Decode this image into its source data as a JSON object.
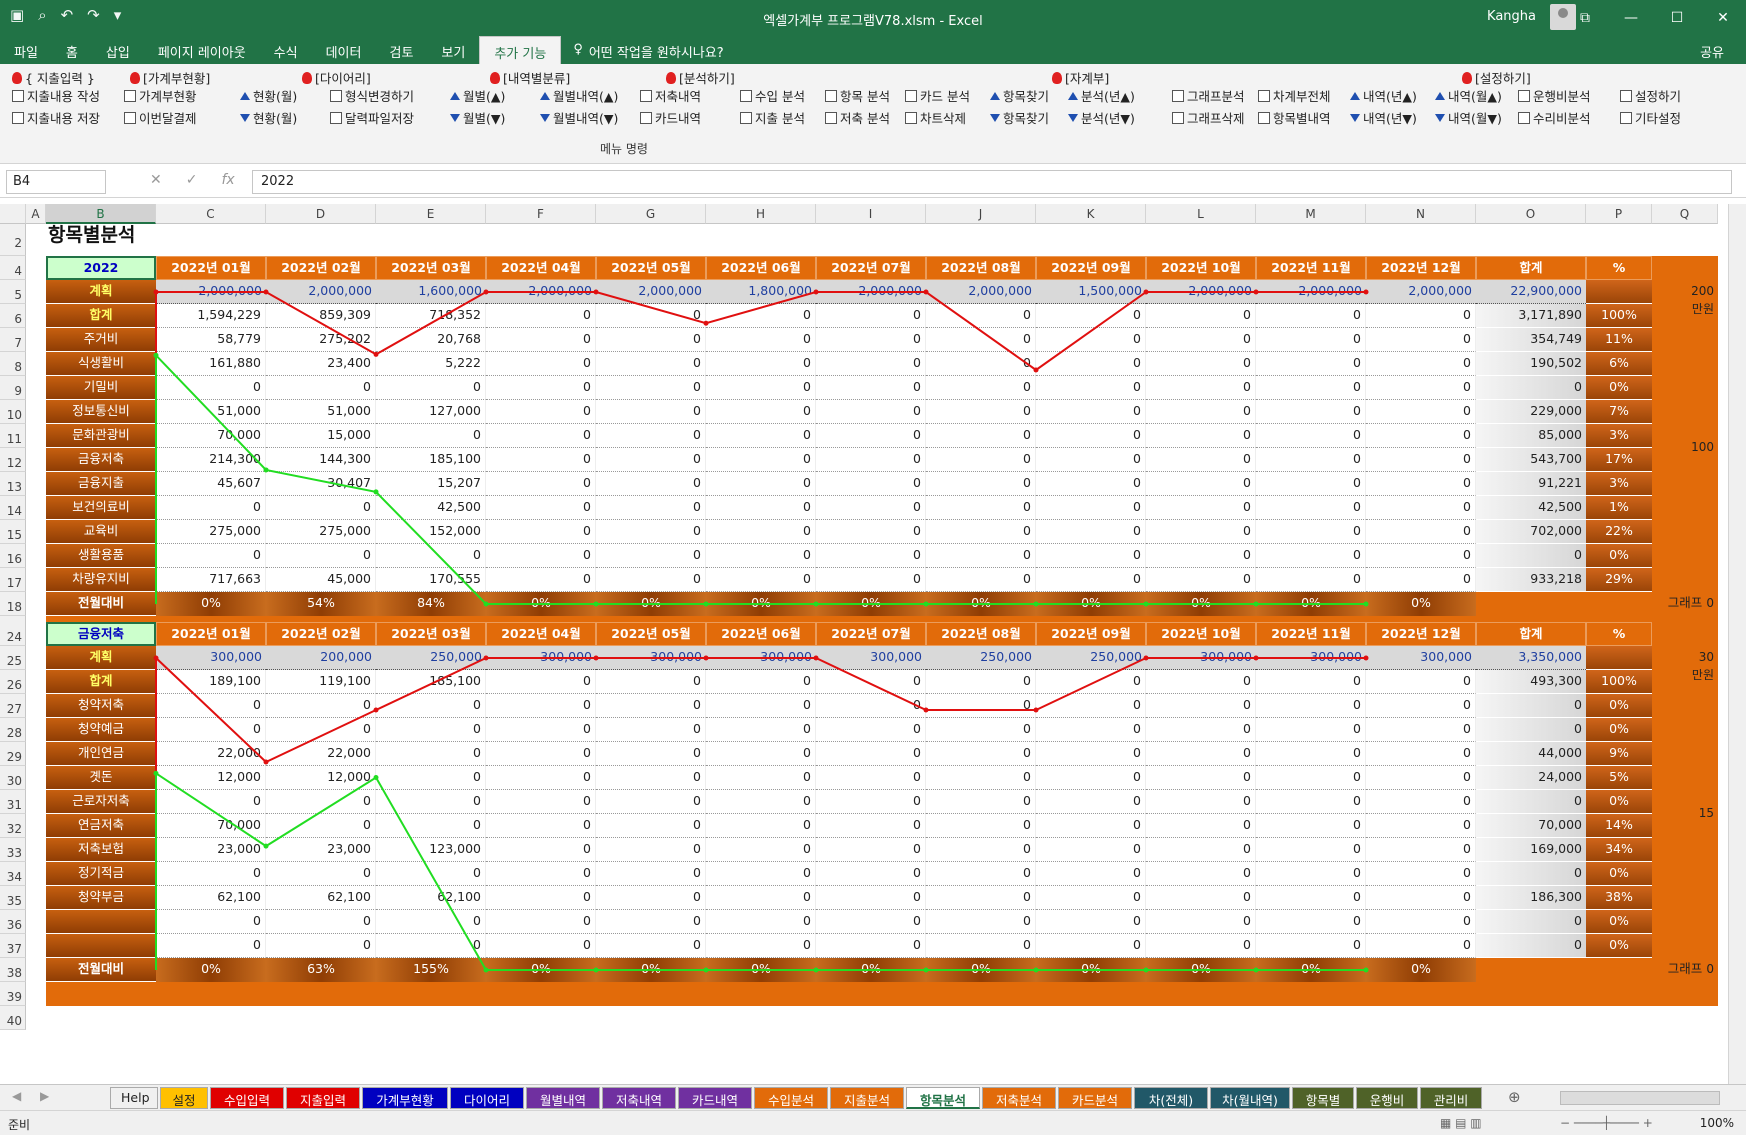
{
  "window": {
    "title": "엑셀가계부 프로그램V78.xlsm  -  Excel",
    "user": "Kangha",
    "qat_icons": [
      "save-icon",
      "print-preview-icon",
      "undo-icon",
      "redo-icon",
      "customize-icon"
    ]
  },
  "tabs": [
    "파일",
    "홈",
    "삽입",
    "페이지 레이아웃",
    "수식",
    "데이터",
    "검토",
    "보기",
    "추가 기능"
  ],
  "active_tab": "추가 기능",
  "tell_me": "어떤 작업을 원하시나요?",
  "share": "공유",
  "ribbon": {
    "headers": [
      "{ 지출입력 }",
      "[가계부현황]",
      "[다이어리]",
      "[내역별분류]",
      "[분석하기]",
      "[자계부]",
      "[설정하기]"
    ],
    "row1": [
      "지출내용 작성",
      "가계부현황",
      "현황(월)",
      "형식변경하기",
      "월별(▲)",
      "월별내역(▲)",
      "저축내역",
      "수입 분석",
      "항목 분석",
      "카드 분석",
      "항목찾기",
      "분석(년▲)",
      "그래프분석",
      "차계부전체",
      "내역(년▲)",
      "내역(월▲)",
      "운행비분석",
      "설정하기"
    ],
    "row2": [
      "지출내용 저장",
      "이번달결제",
      "현황(월)",
      "달력파일저장",
      "월별(▼)",
      "월별내역(▼)",
      "카드내역",
      "지출 분석",
      "저축 분석",
      "차트삭제",
      "항목찾기",
      "분석(년▼)",
      "그래프삭제",
      "항목별내역",
      "내역(년▼)",
      "내역(월▼)",
      "수리비분석",
      "기타설정"
    ],
    "group_label": "메뉴 명령"
  },
  "formula_bar": {
    "name_box": "B4",
    "value": "2022"
  },
  "columns": [
    "A",
    "B",
    "C",
    "D",
    "E",
    "F",
    "G",
    "H",
    "I",
    "J",
    "K",
    "L",
    "M",
    "N",
    "O",
    "P",
    "Q"
  ],
  "selected_column": "B",
  "sheet_title": "항목별분석",
  "months": [
    "2022년 01월",
    "2022년 02월",
    "2022년 03월",
    "2022년 04월",
    "2022년 05월",
    "2022년 06월",
    "2022년 07월",
    "2022년 08월",
    "2022년 09월",
    "2022년 10월",
    "2022년 11월",
    "2022년 12월"
  ],
  "total_label": "합계",
  "pct_label": "%",
  "compare_label": "전월대비",
  "graph_label": "그래프",
  "unit_label": "만원",
  "table1": {
    "selector": "2022",
    "rows": [
      {
        "row": "5",
        "label": "계획",
        "type": "plan",
        "values": [
          "2,000,000",
          "2,000,000",
          "1,600,000",
          "2,000,000",
          "2,000,000",
          "1,800,000",
          "2,000,000",
          "2,000,000",
          "1,500,000",
          "2,000,000",
          "2,000,000",
          "2,000,000"
        ],
        "total": "22,900,000",
        "pct": ""
      },
      {
        "row": "6",
        "label": "합계",
        "type": "sum",
        "values": [
          "1,594,229",
          "859,309",
          "718,352",
          "0",
          "0",
          "0",
          "0",
          "0",
          "0",
          "0",
          "0",
          "0"
        ],
        "total": "3,171,890",
        "pct": "100%"
      },
      {
        "row": "7",
        "label": "주거비",
        "values": [
          "58,779",
          "275,202",
          "20,768",
          "0",
          "0",
          "0",
          "0",
          "0",
          "0",
          "0",
          "0",
          "0"
        ],
        "total": "354,749",
        "pct": "11%"
      },
      {
        "row": "8",
        "label": "식생활비",
        "values": [
          "161,880",
          "23,400",
          "5,222",
          "0",
          "0",
          "0",
          "0",
          "0",
          "0",
          "0",
          "0",
          "0"
        ],
        "total": "190,502",
        "pct": "6%"
      },
      {
        "row": "9",
        "label": "기밀비",
        "values": [
          "0",
          "0",
          "0",
          "0",
          "0",
          "0",
          "0",
          "0",
          "0",
          "0",
          "0",
          "0"
        ],
        "total": "0",
        "pct": "0%"
      },
      {
        "row": "10",
        "label": "정보통신비",
        "values": [
          "51,000",
          "51,000",
          "127,000",
          "0",
          "0",
          "0",
          "0",
          "0",
          "0",
          "0",
          "0",
          "0"
        ],
        "total": "229,000",
        "pct": "7%"
      },
      {
        "row": "11",
        "label": "문화관광비",
        "values": [
          "70,000",
          "15,000",
          "0",
          "0",
          "0",
          "0",
          "0",
          "0",
          "0",
          "0",
          "0",
          "0"
        ],
        "total": "85,000",
        "pct": "3%"
      },
      {
        "row": "12",
        "label": "금융저축",
        "values": [
          "214,300",
          "144,300",
          "185,100",
          "0",
          "0",
          "0",
          "0",
          "0",
          "0",
          "0",
          "0",
          "0"
        ],
        "total": "543,700",
        "pct": "17%"
      },
      {
        "row": "13",
        "label": "금융지출",
        "values": [
          "45,607",
          "30,407",
          "15,207",
          "0",
          "0",
          "0",
          "0",
          "0",
          "0",
          "0",
          "0",
          "0"
        ],
        "total": "91,221",
        "pct": "3%"
      },
      {
        "row": "14",
        "label": "보건의료비",
        "values": [
          "0",
          "0",
          "42,500",
          "0",
          "0",
          "0",
          "0",
          "0",
          "0",
          "0",
          "0",
          "0"
        ],
        "total": "42,500",
        "pct": "1%"
      },
      {
        "row": "15",
        "label": "교육비",
        "values": [
          "275,000",
          "275,000",
          "152,000",
          "0",
          "0",
          "0",
          "0",
          "0",
          "0",
          "0",
          "0",
          "0"
        ],
        "total": "702,000",
        "pct": "22%"
      },
      {
        "row": "16",
        "label": "생활용품",
        "values": [
          "0",
          "0",
          "0",
          "0",
          "0",
          "0",
          "0",
          "0",
          "0",
          "0",
          "0",
          "0"
        ],
        "total": "0",
        "pct": "0%"
      },
      {
        "row": "17",
        "label": "차량유지비",
        "values": [
          "717,663",
          "45,000",
          "170,555",
          "0",
          "0",
          "0",
          "0",
          "0",
          "0",
          "0",
          "0",
          "0"
        ],
        "total": "933,218",
        "pct": "29%"
      }
    ],
    "compare": [
      "0%",
      "54%",
      "84%",
      "0%",
      "0%",
      "0%",
      "0%",
      "0%",
      "0%",
      "0%",
      "0%",
      "0%"
    ],
    "axis": [
      "200",
      "100",
      "0"
    ]
  },
  "table2": {
    "selector": "금융저축",
    "rows": [
      {
        "row": "25",
        "label": "계획",
        "type": "plan",
        "values": [
          "300,000",
          "200,000",
          "250,000",
          "300,000",
          "300,000",
          "300,000",
          "300,000",
          "250,000",
          "250,000",
          "300,000",
          "300,000",
          "300,000"
        ],
        "total": "3,350,000",
        "pct": ""
      },
      {
        "row": "26",
        "label": "합계",
        "type": "sum",
        "values": [
          "189,100",
          "119,100",
          "185,100",
          "0",
          "0",
          "0",
          "0",
          "0",
          "0",
          "0",
          "0",
          "0"
        ],
        "total": "493,300",
        "pct": "100%"
      },
      {
        "row": "27",
        "label": "청약저축",
        "values": [
          "0",
          "0",
          "0",
          "0",
          "0",
          "0",
          "0",
          "0",
          "0",
          "0",
          "0",
          "0"
        ],
        "total": "0",
        "pct": "0%"
      },
      {
        "row": "28",
        "label": "청약예금",
        "values": [
          "0",
          "0",
          "0",
          "0",
          "0",
          "0",
          "0",
          "0",
          "0",
          "0",
          "0",
          "0"
        ],
        "total": "0",
        "pct": "0%"
      },
      {
        "row": "29",
        "label": "개인연금",
        "values": [
          "22,000",
          "22,000",
          "0",
          "0",
          "0",
          "0",
          "0",
          "0",
          "0",
          "0",
          "0",
          "0"
        ],
        "total": "44,000",
        "pct": "9%"
      },
      {
        "row": "30",
        "label": "곗돈",
        "values": [
          "12,000",
          "12,000",
          "0",
          "0",
          "0",
          "0",
          "0",
          "0",
          "0",
          "0",
          "0",
          "0"
        ],
        "total": "24,000",
        "pct": "5%"
      },
      {
        "row": "31",
        "label": "근로자저축",
        "values": [
          "0",
          "0",
          "0",
          "0",
          "0",
          "0",
          "0",
          "0",
          "0",
          "0",
          "0",
          "0"
        ],
        "total": "0",
        "pct": "0%"
      },
      {
        "row": "32",
        "label": "연금저축",
        "values": [
          "70,000",
          "0",
          "0",
          "0",
          "0",
          "0",
          "0",
          "0",
          "0",
          "0",
          "0",
          "0"
        ],
        "total": "70,000",
        "pct": "14%"
      },
      {
        "row": "33",
        "label": "저축보험",
        "values": [
          "23,000",
          "23,000",
          "123,000",
          "0",
          "0",
          "0",
          "0",
          "0",
          "0",
          "0",
          "0",
          "0"
        ],
        "total": "169,000",
        "pct": "34%"
      },
      {
        "row": "34",
        "label": "정기적금",
        "values": [
          "0",
          "0",
          "0",
          "0",
          "0",
          "0",
          "0",
          "0",
          "0",
          "0",
          "0",
          "0"
        ],
        "total": "0",
        "pct": "0%"
      },
      {
        "row": "35",
        "label": "청약부금",
        "values": [
          "62,100",
          "62,100",
          "62,100",
          "0",
          "0",
          "0",
          "0",
          "0",
          "0",
          "0",
          "0",
          "0"
        ],
        "total": "186,300",
        "pct": "38%"
      },
      {
        "row": "36",
        "label": "",
        "values": [
          "0",
          "0",
          "0",
          "0",
          "0",
          "0",
          "0",
          "0",
          "0",
          "0",
          "0",
          "0"
        ],
        "total": "0",
        "pct": "0%"
      },
      {
        "row": "37",
        "label": "",
        "values": [
          "0",
          "0",
          "0",
          "0",
          "0",
          "0",
          "0",
          "0",
          "0",
          "0",
          "0",
          "0"
        ],
        "total": "0",
        "pct": "0%"
      }
    ],
    "compare": [
      "0%",
      "63%",
      "155%",
      "0%",
      "0%",
      "0%",
      "0%",
      "0%",
      "0%",
      "0%",
      "0%",
      "0%"
    ],
    "axis": [
      "30",
      "15",
      "0"
    ]
  },
  "row_numbers_top": [
    "2",
    "4",
    "5",
    "6",
    "7",
    "8",
    "9",
    "10",
    "11",
    "12",
    "13",
    "14",
    "15",
    "16",
    "17",
    "18",
    "19",
    "20"
  ],
  "row_numbers_bottom": [
    "24",
    "25",
    "26",
    "27",
    "28",
    "29",
    "30",
    "31",
    "32",
    "33",
    "34",
    "35",
    "36",
    "37",
    "38",
    "39",
    "40"
  ],
  "sheet_tabs": [
    {
      "label": "Help",
      "bg": "#f0f0f0",
      "fg": "#222"
    },
    {
      "label": "설정",
      "bg": "#ffc000",
      "fg": "#222"
    },
    {
      "label": "수입입력",
      "bg": "#e00000",
      "fg": "#fff"
    },
    {
      "label": "지출입력",
      "bg": "#e00000",
      "fg": "#fff"
    },
    {
      "label": "가계부현황",
      "bg": "#0000c0",
      "fg": "#fff"
    },
    {
      "label": "다이어리",
      "bg": "#0000c0",
      "fg": "#fff"
    },
    {
      "label": "월별내역",
      "bg": "#7030a0",
      "fg": "#fff"
    },
    {
      "label": "저축내역",
      "bg": "#7030a0",
      "fg": "#fff"
    },
    {
      "label": "카드내역",
      "bg": "#7030a0",
      "fg": "#fff"
    },
    {
      "label": "수입분석",
      "bg": "#e26b0a",
      "fg": "#fff"
    },
    {
      "label": "지출분석",
      "bg": "#e26b0a",
      "fg": "#fff"
    },
    {
      "label": "항목분석",
      "bg": "#ffffff",
      "fg": "#217346"
    },
    {
      "label": "저축분석",
      "bg": "#e26b0a",
      "fg": "#fff"
    },
    {
      "label": "카드분석",
      "bg": "#e26b0a",
      "fg": "#fff"
    },
    {
      "label": "차(전체)",
      "bg": "#215868",
      "fg": "#fff"
    },
    {
      "label": "차(월내역)",
      "bg": "#215868",
      "fg": "#fff"
    },
    {
      "label": "항목별",
      "bg": "#4f6228",
      "fg": "#fff"
    },
    {
      "label": "운행비",
      "bg": "#4f6228",
      "fg": "#fff"
    },
    {
      "label": "관리비",
      "bg": "#4f6228",
      "fg": "#fff"
    }
  ],
  "status": {
    "ready": "준비",
    "zoom": "100%"
  },
  "colors": {
    "excel_green": "#217346",
    "orange": "#e26b0a",
    "plan_line": "#e01010",
    "sum_line": "#22dd22"
  }
}
